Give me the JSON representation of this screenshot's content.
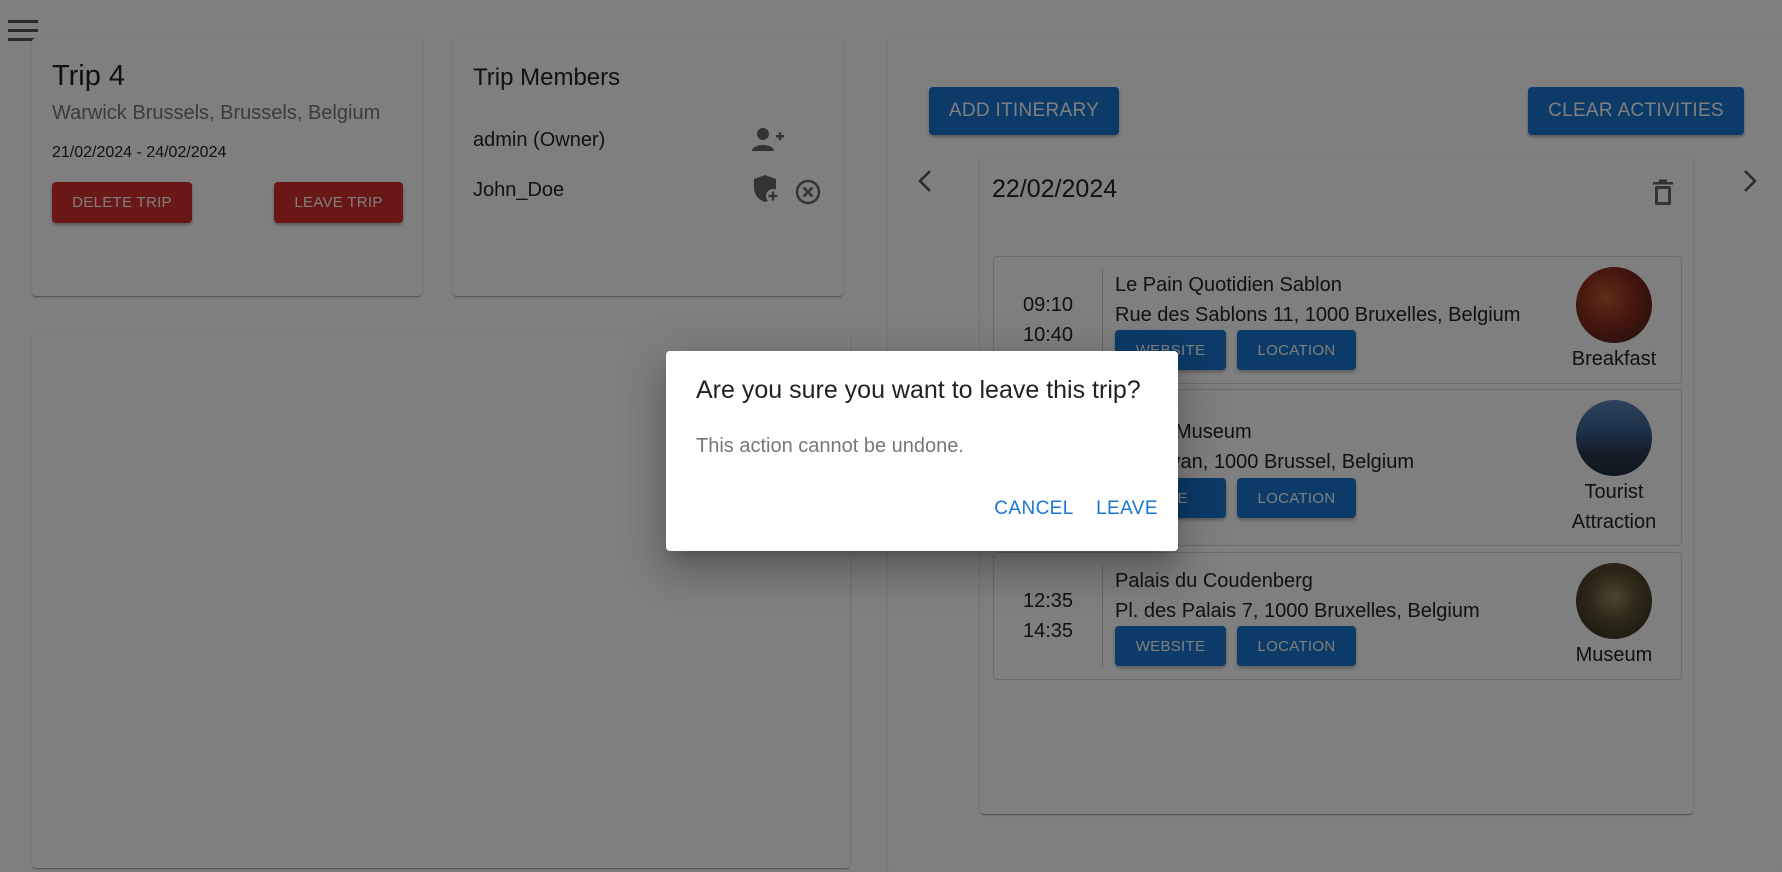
{
  "trip": {
    "title": "Trip 4",
    "hotel": "Warwick Brussels, Brussels, Belgium",
    "dates": "21/02/2024 - 24/02/2024",
    "delete_label": "DELETE TRIP",
    "leave_label": "LEAVE TRIP"
  },
  "members": {
    "title": "Trip Members",
    "list": [
      {
        "name": "admin (Owner)"
      },
      {
        "name": "John_Doe"
      }
    ]
  },
  "itinerary": {
    "add_label": "ADD ITINERARY",
    "clear_label": "CLEAR ACTIVITIES",
    "date": "22/02/2024",
    "website_label": "WEBSITE",
    "location_label": "LOCATION",
    "activities": [
      {
        "start": "09:10",
        "end": "10:40",
        "name": "Le Pain Quotidien Sablon",
        "address": "Rue des Sablons 11, 1000 Bruxelles, Belgium",
        "category": "Breakfast"
      },
      {
        "start": "",
        "end": "",
        "name": "ls City Museum",
        "address": "Markt van, 1000 Brussel, Belgium",
        "category_line1": "Tourist",
        "category_line2": "Attraction"
      },
      {
        "start": "12:35",
        "end": "14:35",
        "name": "Palais du Coudenberg",
        "address": "Pl. des Palais 7, 1000 Bruxelles, Belgium",
        "category": "Museum"
      }
    ],
    "partial_website_label": "SITE"
  },
  "dialog": {
    "title": "Are you sure you want to leave this trip?",
    "message": "This action cannot be undone.",
    "cancel_label": "CANCEL",
    "leave_label": "LEAVE"
  },
  "colors": {
    "primary": "#1976d2",
    "danger": "#d32f2f",
    "overlay": "rgba(0,0,0,0.5)"
  }
}
